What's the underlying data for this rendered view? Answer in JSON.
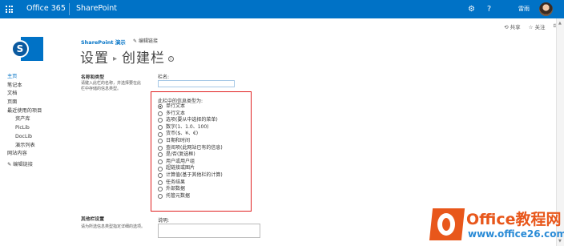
{
  "suitebar": {
    "brand": "Office 365",
    "app": "SharePoint",
    "settings_icon": "gear-icon",
    "help_icon": "question-icon",
    "user_name": "雷雨"
  },
  "actions": {
    "share": "共享",
    "follow": "关注"
  },
  "site": {
    "name": "SharePoint 演示",
    "edit_links": "编辑链接"
  },
  "page": {
    "title_part1": "设置",
    "title_part2": "创建栏"
  },
  "nav": {
    "items": [
      {
        "label": "主页",
        "selected": true
      },
      {
        "label": "笔记本"
      },
      {
        "label": "文档"
      },
      {
        "label": "页面"
      },
      {
        "label": "最近使用的项目"
      },
      {
        "label": "资产库",
        "sub": true
      },
      {
        "label": "PicLib",
        "sub": true
      },
      {
        "label": "DocLib",
        "sub": true
      },
      {
        "label": "演示列表",
        "sub": true
      },
      {
        "label": "网站内容"
      }
    ],
    "edit_links": "编辑链接"
  },
  "form": {
    "name_type_title": "名称和类型",
    "name_type_desc": "请键入此栏的名称，并选择要在此栏中存储的信息类型。",
    "column_name_label": "栏名:",
    "column_name_value": "",
    "type_prompt": "此栏中的信息类型为:",
    "types": [
      {
        "label": "单行文本",
        "checked": true
      },
      {
        "label": "多行文本"
      },
      {
        "label": "选项(要从中选择的菜单)"
      },
      {
        "label": "数字(1、1.0、100)"
      },
      {
        "label": "货币($、¥、€)"
      },
      {
        "label": "日期和时间"
      },
      {
        "label": "查阅项(此网站已有的信息)"
      },
      {
        "label": "是/否(复选框)"
      },
      {
        "label": "用户或用户组"
      },
      {
        "label": "超链接或图片"
      },
      {
        "label": "计算值(基于其他栏的计算)"
      },
      {
        "label": "任务结果"
      },
      {
        "label": "外部数据"
      },
      {
        "label": "托管元数据"
      }
    ],
    "other_settings_title": "其他栏设置",
    "other_settings_desc": "请为所选信息类型指定详细的选项。",
    "description_label": "说明:"
  },
  "watermark": {
    "line1": "Office教程网",
    "line2": "www.office26.com"
  },
  "colors": {
    "suitebar": "#0072c6",
    "highlight": "#e02020",
    "watermark_orange": "#e8571b"
  }
}
